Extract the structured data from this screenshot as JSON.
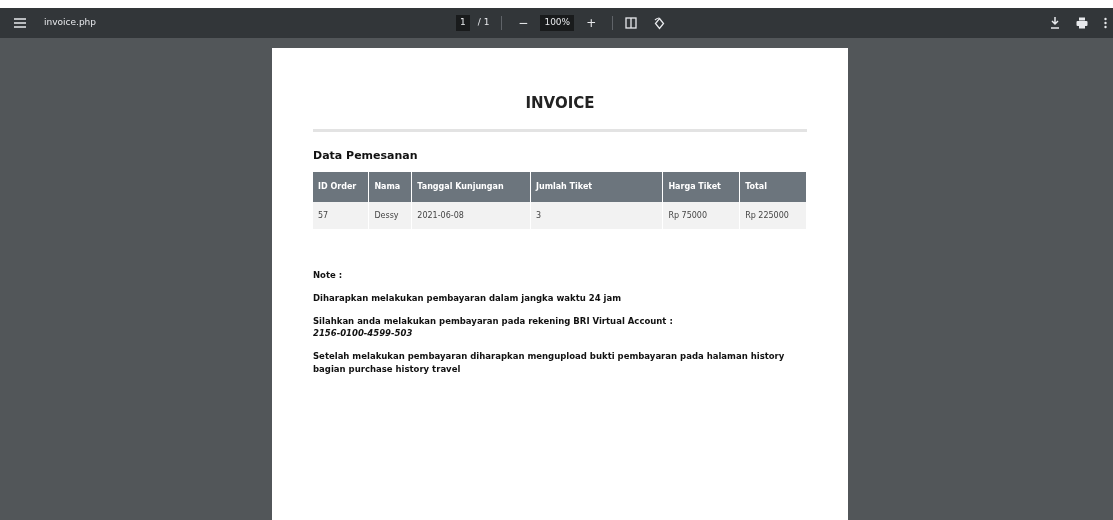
{
  "toolbar": {
    "title": "invoice.php",
    "page": "1",
    "page_count": "/ 1",
    "zoom": "100%",
    "zoom_out": "−",
    "zoom_in": "+"
  },
  "document": {
    "heading": "INVOICE",
    "section_title": "Data Pemesanan",
    "table": {
      "columns": [
        "ID Order",
        "Nama",
        "Tanggal Kunjungan",
        "Jumlah Tiket",
        "Harga Tiket",
        "Total"
      ],
      "rows": [
        [
          "57",
          "Dessy",
          "2021-06-08",
          "3",
          "Rp 75000",
          "Rp 225000"
        ]
      ]
    },
    "note_label": "Note :",
    "notes": [
      {
        "text": "Diharapkan melakukan pembayaran dalam jangka waktu 24 jam"
      },
      {
        "text": "Silahkan anda melakukan pembayaran pada rekening BRI Virtual Account :",
        "account": "2156-0100-4599-503"
      },
      {
        "text": "Setelah melakukan pembayaran diharapkan mengupload bukti pembayaran pada halaman history bagian purchase history travel"
      }
    ]
  }
}
